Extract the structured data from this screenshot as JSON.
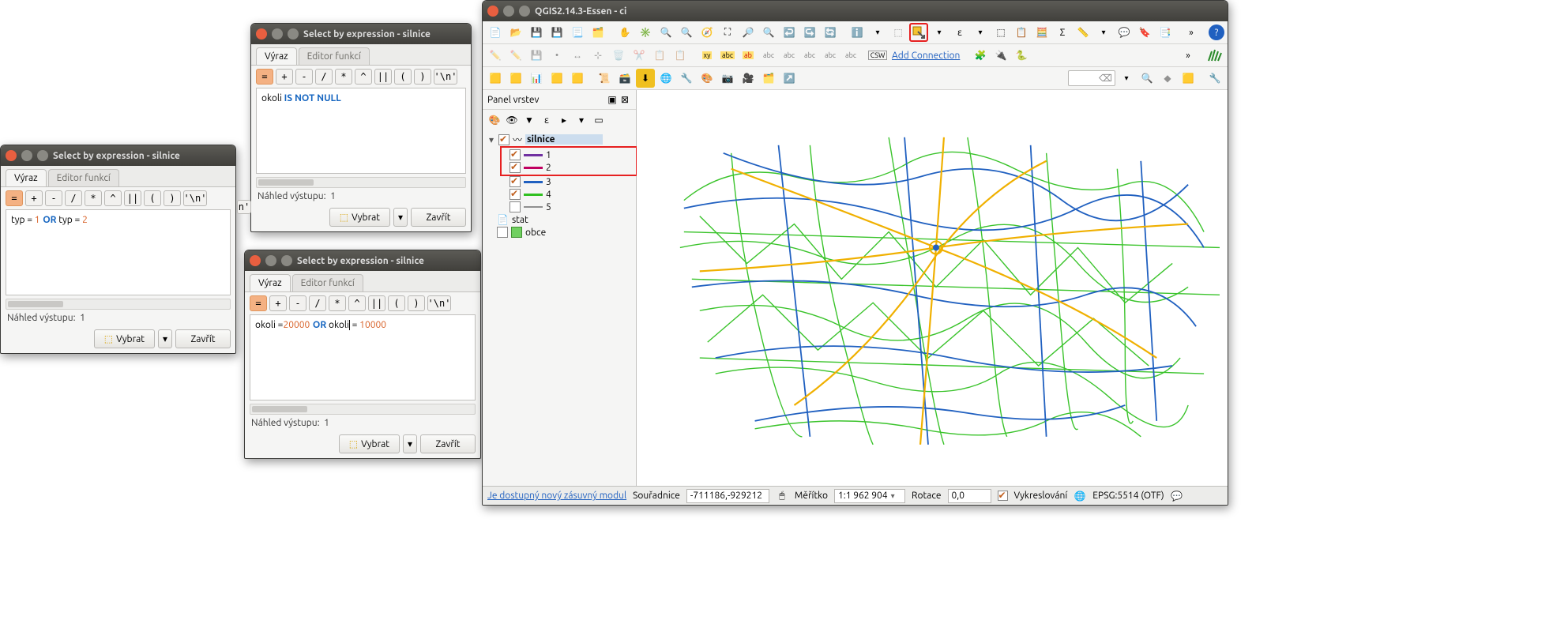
{
  "dialogs": {
    "title": "Select by expression - silnice",
    "tabs": {
      "expr": "Výraz",
      "func": "Editor funkcí"
    },
    "ops": [
      "=",
      "+",
      "-",
      "/",
      "*",
      "^",
      "||",
      "(",
      ")",
      "'\\n'"
    ],
    "preview_label": "Náhled výstupu:",
    "preview_value": "1",
    "select_label": "Vybrat",
    "close_label": "Zavřít",
    "expr1": {
      "a": "typ = ",
      "n1": "1",
      "or": "OR",
      "b": " typ = ",
      "n2": "2"
    },
    "expr2": {
      "a": "okoli ",
      "kw": "IS NOT NULL"
    },
    "expr3": {
      "a": "okoli =",
      "n1": "20000",
      "or": "OR",
      "b": " okoli",
      "c": " = ",
      "n2": "10000"
    },
    "n_suffix": "n'"
  },
  "main": {
    "title": "QGIS2.14.3-Essen - ci",
    "add_connection": "Add Connection",
    "panel_title": "Panel vrstev",
    "layers": {
      "root": "silnice",
      "items": [
        {
          "label": "1",
          "color": "#7030a0",
          "checked": true
        },
        {
          "label": "2",
          "color": "#c00060",
          "checked": true
        },
        {
          "label": "3",
          "color": "#2060c0",
          "checked": true
        },
        {
          "label": "4",
          "color": "#30c020",
          "checked": true
        },
        {
          "label": "5",
          "color": "#909090",
          "checked": false
        }
      ],
      "stat": "stat",
      "obce": "obce"
    },
    "status": {
      "plugin": "Je dostupný nový zásuvný modul",
      "coord_label": "Souřadnice",
      "coord_value": "-711186,-929212",
      "scale_label": "Měřítko",
      "scale_value": "1:1 962 904",
      "rot_label": "Rotace",
      "rot_value": "0,0",
      "render_label": "Vykreslování",
      "crs": "EPSG:5514 (OTF)"
    }
  }
}
